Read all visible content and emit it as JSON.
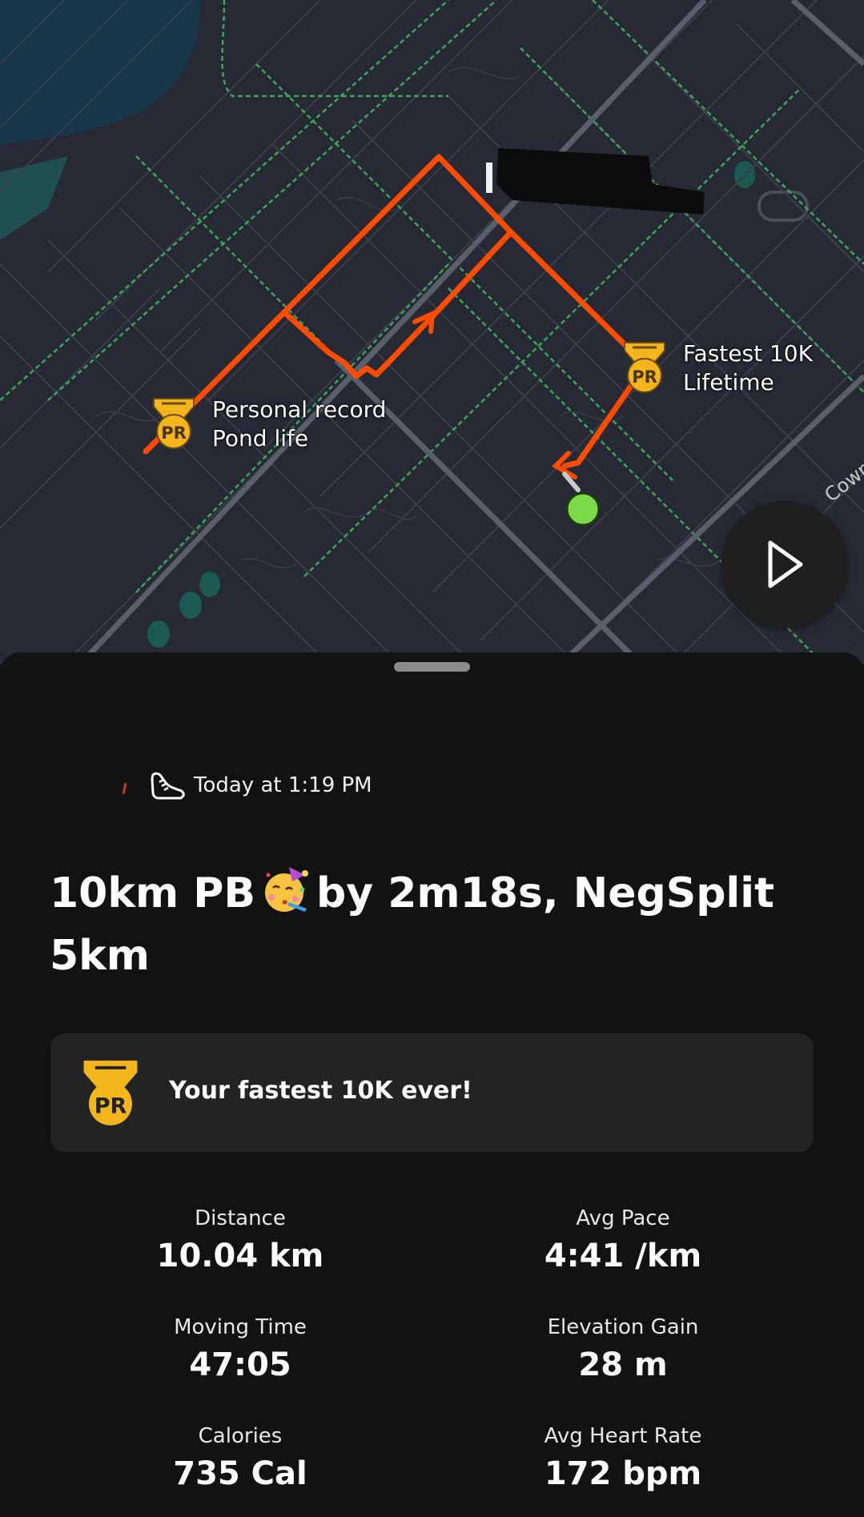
{
  "map": {
    "markers": [
      {
        "title": "Personal record",
        "subtitle": "Pond life",
        "badge": "PR"
      },
      {
        "title": "Fastest 10K",
        "subtitle": "Lifetime",
        "badge": "PR"
      }
    ],
    "street_label": "Cowr",
    "route_color": "#fc4c02",
    "end_dot_color": "#7ed94a",
    "play_icon": "play-icon"
  },
  "activity": {
    "sport_icon": "running-shoe-icon",
    "timestamp": "Today at 1:19 PM",
    "title_part1": "10km PB",
    "title_emoji": "partying-face-emoji",
    "title_part2": "by 2m18s, NegSplit 5km"
  },
  "achievement": {
    "badge": "PR",
    "text": "Your fastest 10K ever!",
    "medal_color": "#f2b51c"
  },
  "stats": [
    {
      "label": "Distance",
      "value": "10.04 km"
    },
    {
      "label": "Avg Pace",
      "value": "4:41 /km"
    },
    {
      "label": "Moving Time",
      "value": "47:05"
    },
    {
      "label": "Elevation Gain",
      "value": "28 m"
    },
    {
      "label": "Calories",
      "value": "735 Cal"
    },
    {
      "label": "Avg Heart Rate",
      "value": "172 bpm"
    }
  ]
}
